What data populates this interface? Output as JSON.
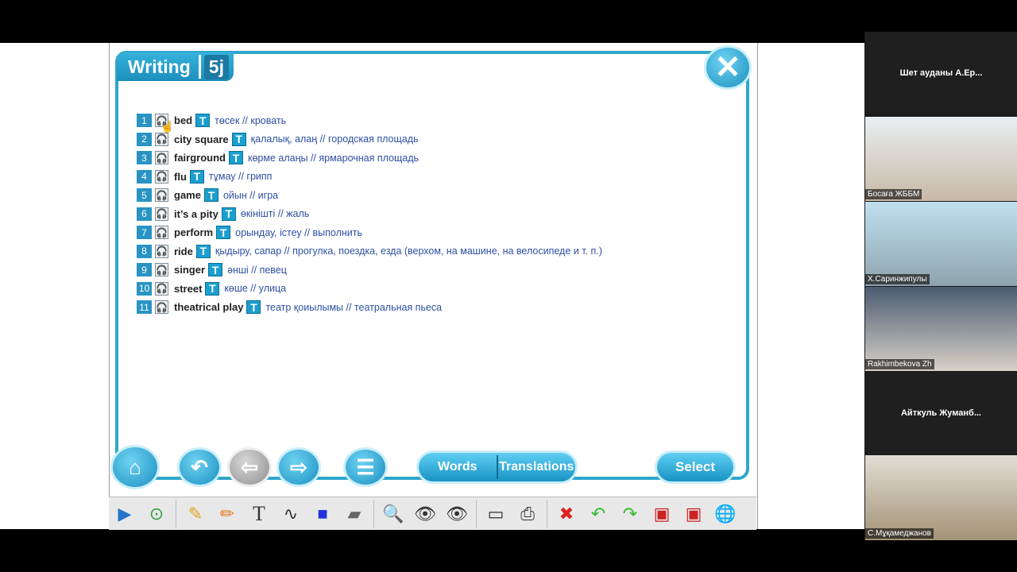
{
  "header": {
    "title": "Writing",
    "unit": "5j"
  },
  "list": {
    "items": [
      {
        "num": "1",
        "word": "bed",
        "translation": "төсек // кровать"
      },
      {
        "num": "2",
        "word": "city square",
        "translation": "қалалық, алаң // городская площадь"
      },
      {
        "num": "3",
        "word": "fairground",
        "translation": "көрме алаңы // ярмарочная площадь"
      },
      {
        "num": "4",
        "word": "flu",
        "translation": "тұмау // грипп"
      },
      {
        "num": "5",
        "word": "game",
        "translation": "ойын // игра"
      },
      {
        "num": "6",
        "word": "it’s a pity",
        "translation": "өкінішті // жаль"
      },
      {
        "num": "7",
        "word": "perform",
        "translation": "орындау, істеу // выполнить"
      },
      {
        "num": "8",
        "word": "ride",
        "translation": "қыдыру, сапар // прогулка, поездка, езда (верхом, на машине, на велосипеде и т. п.)"
      },
      {
        "num": "9",
        "word": "singer",
        "translation": "әнші // певец"
      },
      {
        "num": "10",
        "word": "street",
        "translation": "көше // улица"
      },
      {
        "num": "11",
        "word": "theatrical play",
        "translation": "театр қоиылымы // театральная пьеса"
      }
    ]
  },
  "buttons": {
    "words": "Words",
    "translations": "Translations",
    "select": "Select",
    "text_tool": "T"
  },
  "participants": [
    {
      "name": "Шет ауданы А.Ер..."
    },
    {
      "name": "Босаға ЖББМ"
    },
    {
      "name": "Х.Саринжипулы"
    },
    {
      "name": "Rakhimbekova Zh"
    },
    {
      "name": "Айткуль Жуманб..."
    },
    {
      "name": "С.Мұқамеджанов"
    }
  ],
  "colors": {
    "accent": "#2fa6cc",
    "number_bg": "#2994c4",
    "translation_text": "#2d4fa3"
  }
}
